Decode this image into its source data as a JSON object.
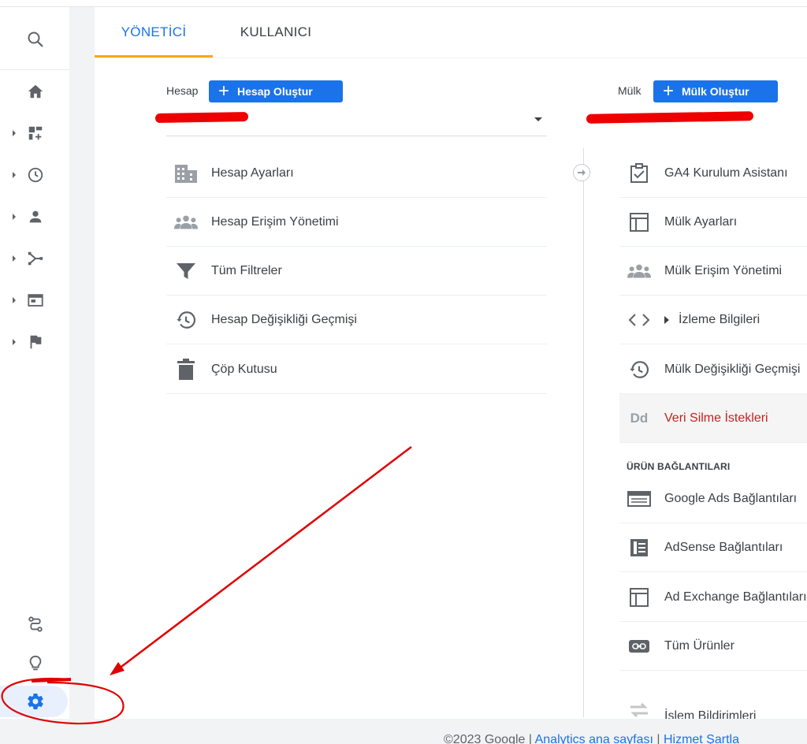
{
  "tabs": [
    {
      "label": "YÖNETİCİ",
      "active": true
    },
    {
      "label": "KULLANICI",
      "active": false
    }
  ],
  "rail": {
    "items": [
      {
        "icon": "search-icon"
      },
      {
        "icon": "home-icon"
      },
      {
        "icon": "dashboard-icon"
      },
      {
        "icon": "clock-icon"
      },
      {
        "icon": "person-icon"
      },
      {
        "icon": "acquisition-icon"
      },
      {
        "icon": "behavior-icon"
      },
      {
        "icon": "flag-icon"
      },
      {
        "icon": "route-icon"
      },
      {
        "icon": "lightbulb-icon"
      },
      {
        "icon": "gear-icon"
      }
    ]
  },
  "account": {
    "label": "Hesap",
    "create_label": "Hesap Oluştur",
    "items": [
      {
        "label": "Hesap Ayarları",
        "icon": "building-icon"
      },
      {
        "label": "Hesap Erişim Yönetimi",
        "icon": "people-icon"
      },
      {
        "label": "Tüm Filtreler",
        "icon": "filter-icon"
      },
      {
        "label": "Hesap Değişikliği Geçmişi",
        "icon": "history-icon"
      },
      {
        "label": "Çöp Kutusu",
        "icon": "trash-icon"
      }
    ]
  },
  "property": {
    "label": "Mülk",
    "create_label": "Mülk Oluştur",
    "items": [
      {
        "label": "GA4 Kurulum Asistanı",
        "icon": "checkbox-icon"
      },
      {
        "label": "Mülk Ayarları",
        "icon": "layout-icon"
      },
      {
        "label": "Mülk Erişim Yönetimi",
        "icon": "people-icon"
      },
      {
        "label": "İzleme Bilgileri",
        "icon": "code-icon"
      },
      {
        "label": "Mülk Değişikliği Geçmişi",
        "icon": "history-icon"
      },
      {
        "label": "Veri Silme İstekleri",
        "icon": "dd-icon"
      }
    ],
    "section_title": "ÜRÜN BAĞLANTILARI",
    "link_items": [
      {
        "label": "Google Ads Bağlantıları",
        "icon": "ads-icon"
      },
      {
        "label": "AdSense Bağlantıları",
        "icon": "adsense-icon"
      },
      {
        "label": "Ad Exchange Bağlantıları",
        "icon": "layout-icon"
      },
      {
        "label": "Tüm Ürünler",
        "icon": "link-icon"
      },
      {
        "label": "İşlem Bildirimleri",
        "icon": "postback-icon"
      }
    ]
  },
  "footer": {
    "copyright": "©2023 Google",
    "sep": "|",
    "link1": "Analytics ana sayfası",
    "link2": "Hizmet Şartla"
  },
  "colors": {
    "accent": "#1a73e8",
    "tab_underline": "#f9ab00",
    "danger_text": "#c5221f",
    "annotation": "#e00000"
  }
}
